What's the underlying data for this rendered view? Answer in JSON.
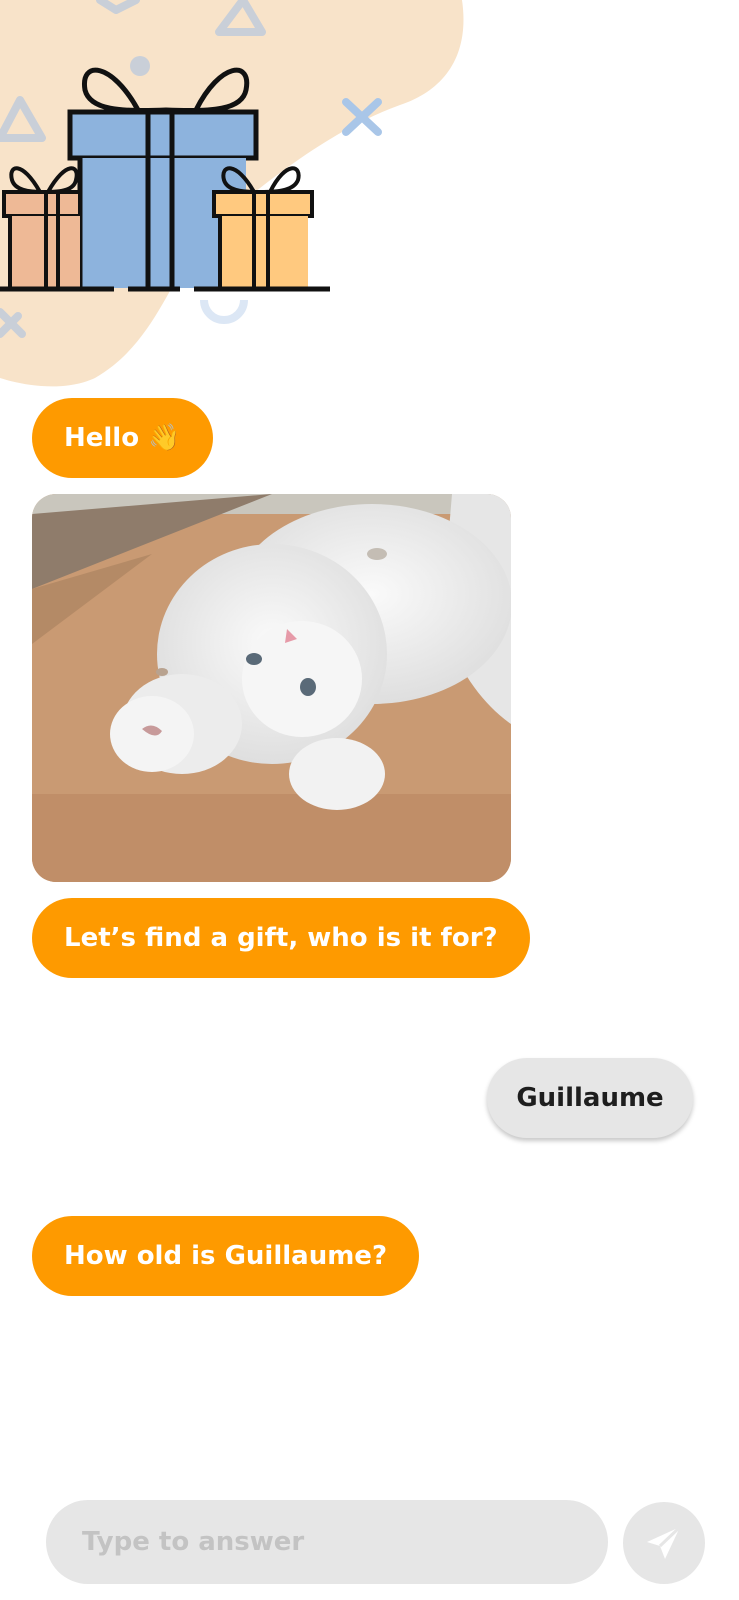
{
  "chat": {
    "messages": [
      {
        "from": "bot",
        "text": "Hello 👋"
      },
      {
        "from": "bot",
        "type": "image",
        "content": "gift-cat photo"
      },
      {
        "from": "bot",
        "text": "Let’s find a gift, who is it for?"
      },
      {
        "from": "user",
        "text": "Guillaume"
      },
      {
        "from": "bot",
        "text": "How old is Guillaume?"
      }
    ]
  },
  "composer": {
    "placeholder": "Type to answer",
    "value": ""
  },
  "colors": {
    "bot_bubble": "#fe9a00",
    "user_bubble": "#e6e6e6",
    "header_blob": "#f8e3c9",
    "gift_blue": "#8db3dd",
    "gift_peach": "#eeb996",
    "gift_yellow": "#ffc97f"
  },
  "icons": {
    "send": "paper-plane-icon",
    "header": "gift-boxes-illustration"
  }
}
